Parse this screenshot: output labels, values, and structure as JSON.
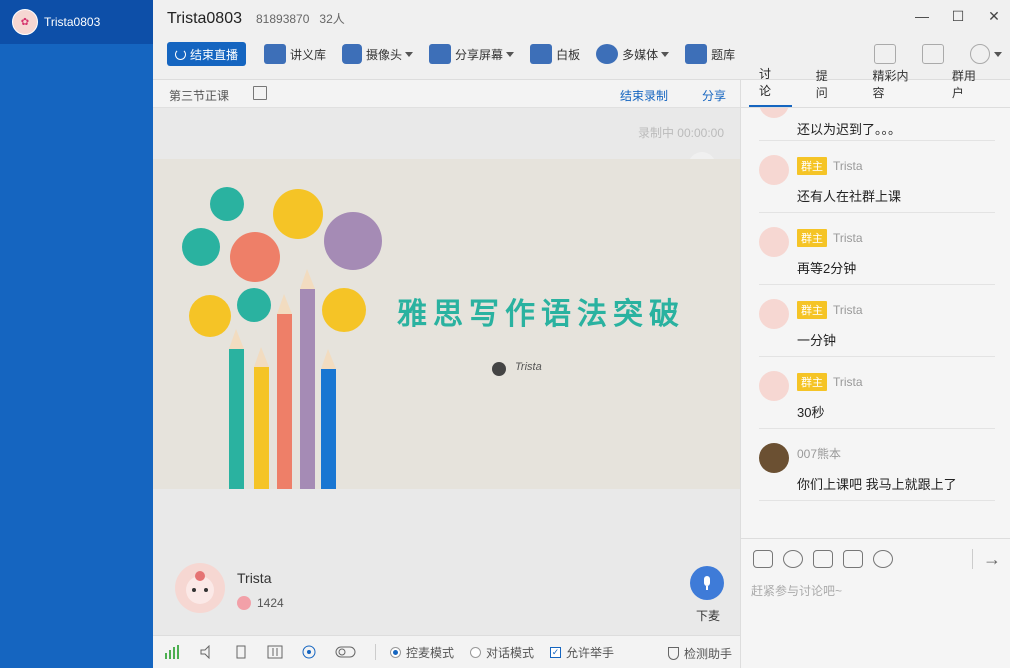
{
  "sidebar": {
    "user_name": "Trista0803"
  },
  "header": {
    "title": "Trista0803",
    "room_id": "81893870",
    "people": "32人"
  },
  "window": {
    "minimize": "—",
    "maximize": "☐",
    "close": "✕"
  },
  "toolbar": {
    "end_live": "结束直播",
    "items": [
      {
        "label": "讲义库",
        "icon": "courseware-icon",
        "dropdown": false
      },
      {
        "label": "摄像头",
        "icon": "camera-icon",
        "dropdown": true
      },
      {
        "label": "分享屏幕",
        "icon": "share-screen-icon",
        "dropdown": true
      },
      {
        "label": "白板",
        "icon": "whiteboard-icon",
        "dropdown": false
      },
      {
        "label": "多媒体",
        "icon": "multimedia-icon",
        "dropdown": true
      },
      {
        "label": "题库",
        "icon": "question-bank-icon",
        "dropdown": false
      }
    ]
  },
  "subbar": {
    "lesson": "第三节正课",
    "end_record": "结束录制",
    "share": "分享"
  },
  "stage": {
    "rec_status": "录制中 00:00:00",
    "slide_title": "雅思写作语法突破",
    "slide_author": "Trista",
    "presenter_name": "Trista",
    "flower_count": "1424",
    "mic_label": "下麦"
  },
  "statusbar": {
    "mode_control": "控麦模式",
    "mode_dialog": "对话模式",
    "allow_hand": "允许举手",
    "detect": "检测助手"
  },
  "tabs": [
    "讨论",
    "提问",
    "精彩内容",
    "群用户"
  ],
  "chat": [
    {
      "badge": "",
      "name": "",
      "text": "还以为迟到了。。。"
    },
    {
      "badge": "群主",
      "name": "Trista",
      "text": "还有人在社群上课"
    },
    {
      "badge": "群主",
      "name": "Trista",
      "text": "再等2分钟"
    },
    {
      "badge": "群主",
      "name": "Trista",
      "text": "一分钟"
    },
    {
      "badge": "群主",
      "name": "Trista",
      "text": "30秒"
    },
    {
      "badge": "",
      "name": "007熊本",
      "text": "你们上课吧 我马上就跟上了"
    }
  ],
  "chat_input_placeholder": "赶紧参与讨论吧~",
  "colors": {
    "sidebar": "#1565c0",
    "accent": "#1565c0",
    "badge": "#f5c426",
    "slide_title": "#2ab2a0"
  }
}
